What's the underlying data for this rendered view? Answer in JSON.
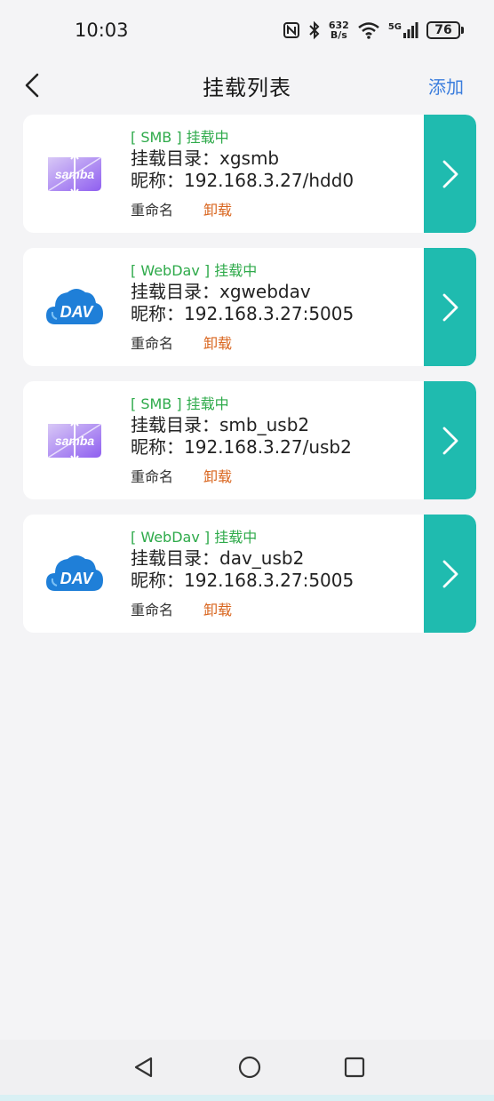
{
  "status_bar": {
    "time": "10:03",
    "net_speed_value": "632",
    "net_speed_unit": "B/s",
    "signal_label": "5G",
    "battery": "76"
  },
  "header": {
    "title": "挂载列表",
    "add_label": "添加"
  },
  "mounts": [
    {
      "type": "samba",
      "status": "[ SMB ] 挂载中",
      "directory": "挂载目录：xgsmb",
      "nickname": "昵称：192.168.3.27/hdd0",
      "rename_label": "重命名",
      "unmount_label": "卸载"
    },
    {
      "type": "webdav",
      "status": "[ WebDav ] 挂载中",
      "directory": "挂载目录：xgwebdav",
      "nickname": "昵称：192.168.3.27:5005",
      "rename_label": "重命名",
      "unmount_label": "卸载"
    },
    {
      "type": "samba",
      "status": "[ SMB ] 挂载中",
      "directory": "挂载目录：smb_usb2",
      "nickname": "昵称：192.168.3.27/usb2",
      "rename_label": "重命名",
      "unmount_label": "卸载"
    },
    {
      "type": "webdav",
      "status": "[ WebDav ] 挂载中",
      "directory": "挂载目录：dav_usb2",
      "nickname": "昵称：192.168.3.27:5005",
      "rename_label": "重命名",
      "unmount_label": "卸载"
    }
  ],
  "logos": {
    "samba_text": "samba",
    "webdav_text": "DAV"
  },
  "colors": {
    "accent": "#1fbbaf",
    "status_green": "#2eaa4a",
    "unmount_orange": "#d9661f",
    "link_blue": "#3b7ddd"
  },
  "icons": {
    "back": "back-arrow-icon",
    "chevron": "chevron-right-icon",
    "nav_back": "triangle-back-icon",
    "nav_home": "circle-home-icon",
    "nav_recent": "square-recent-icon"
  }
}
